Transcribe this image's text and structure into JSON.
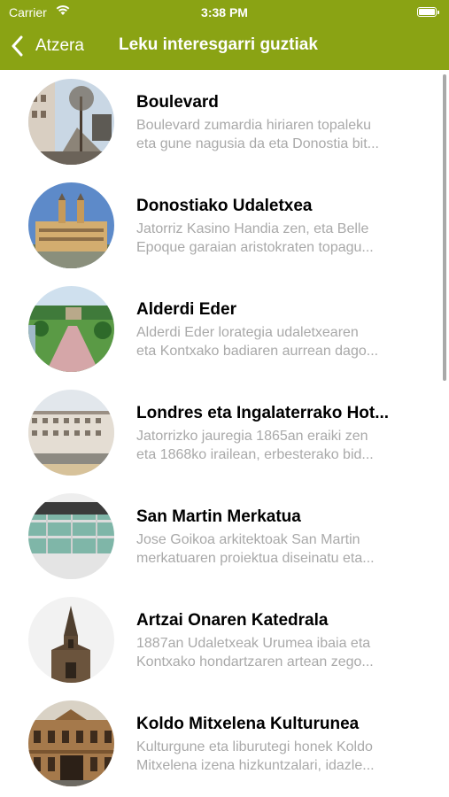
{
  "status_bar": {
    "carrier": "Carrier",
    "time": "3:38 PM"
  },
  "nav": {
    "back_label": "Atzera",
    "title": "Leku interesgarri guztiak"
  },
  "colors": {
    "accent": "#8aa314",
    "description": "#a9a9a9"
  },
  "items": [
    {
      "title": "Boulevard",
      "line1": "Boulevard zumardia hiriaren topaleku",
      "line2": "eta gune nagusia da eta Donostia bit..."
    },
    {
      "title": "Donostiako Udaletxea",
      "line1": "Jatorriz Kasino Handia zen, eta Belle",
      "line2": "Epoque garaian aristokraten topagu..."
    },
    {
      "title": "Alderdi Eder",
      "line1": "Alderdi Eder lorategia udaletxearen",
      "line2": "eta Kontxako badiaren aurrean dago..."
    },
    {
      "title": "Londres eta Ingalaterrako Hot...",
      "line1": "Jatorrizko jauregia 1865an eraiki zen",
      "line2": "eta 1868ko irailean, erbesterako bid..."
    },
    {
      "title": "San Martin Merkatua",
      "line1": "Jose Goikoa arkitektoak San Martin",
      "line2": "merkatuaren proiektua diseinatu eta..."
    },
    {
      "title": "Artzai Onaren Katedrala",
      "line1": "1887an Udaletxeak Urumea ibaia eta",
      "line2": "Kontxako hondartzaren artean zego..."
    },
    {
      "title": "Koldo Mitxelena Kulturunea",
      "line1": "Kulturgune eta liburutegi honek Koldo",
      "line2": "Mitxelena izena hizkuntzalari, idazle..."
    }
  ]
}
